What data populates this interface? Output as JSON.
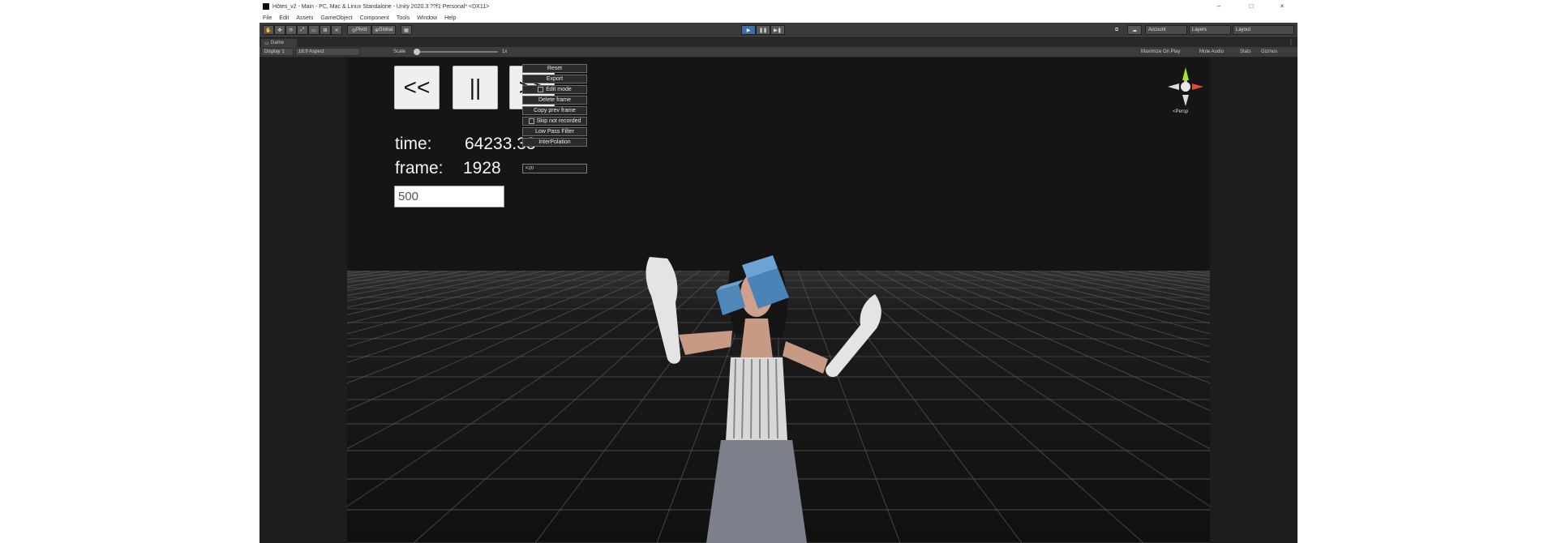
{
  "window": {
    "title": "Hôtes_v2 - Main - PC, Mac & Linux Standalone - Unity 2020.3.??f1 Personal* <DX11>",
    "controls": [
      "–",
      "□",
      "×"
    ]
  },
  "menu": [
    "File",
    "Edit",
    "Assets",
    "GameObject",
    "Component",
    "Tools",
    "Window",
    "Help"
  ],
  "toolbar": {
    "pivot_label": "Pivot",
    "global_label": "Global",
    "account_label": "Account",
    "layers_label": "Layers",
    "layout_label": "Layout"
  },
  "scene": {
    "tab_label": "Game",
    "display_label": "Display 1",
    "aspect_label": "16:9 Aspect",
    "scale_label": "Scale",
    "scale_value": "1x",
    "maximize_label": "Maximize On Play",
    "mute_label": "Mute Audio",
    "stats_label": "Stats",
    "gizmos_label": "Gizmos"
  },
  "gui": {
    "prev_label": "<<",
    "pause_label": "||",
    "next_label": ">>",
    "time_label": "time:",
    "time_value": "64233.33",
    "frame_label": "frame:",
    "frame_value": "1928",
    "frames_input_value": "500",
    "small_input_value": "<20",
    "menu_items": [
      {
        "label": "Reset"
      },
      {
        "label": "Export"
      },
      {
        "label": "Edit mode",
        "checkbox": true
      },
      {
        "label": "Delete frame"
      },
      {
        "label": "Copy prev frame"
      },
      {
        "label": "Skip not recorded",
        "checkbox": true
      },
      {
        "label": "Low Pass Filter"
      },
      {
        "label": "InterPolation"
      }
    ]
  },
  "gizmo": {
    "label": "<Persp"
  },
  "colors": {
    "editor_bg": "#1d1d1d",
    "toolbar_bg": "#3a3a3a",
    "viewport_bg": "#151515",
    "floor_grid": "#5a5a5a",
    "play_active": "#3d6ea8"
  }
}
